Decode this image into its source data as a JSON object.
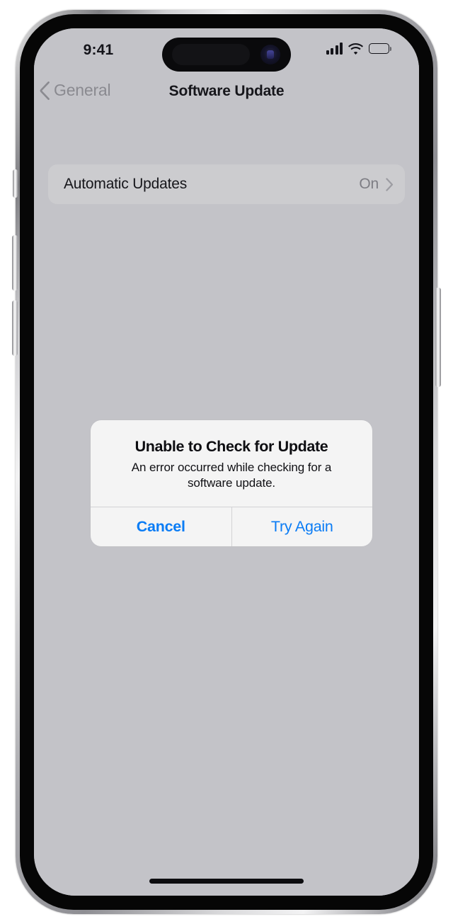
{
  "device": {
    "frame_name": "iphone-frame",
    "buttons": [
      "action-button",
      "volume-up",
      "volume-down",
      "power-button"
    ]
  },
  "status_bar": {
    "time": "9:41",
    "cellular_icon": "cellular-signal-icon",
    "cellular_bars": 4,
    "wifi_icon": "wifi-icon",
    "battery_icon": "battery-icon",
    "battery_level_percent": 100
  },
  "nav_bar": {
    "back_label": "General",
    "back_icon": "chevron-left-icon",
    "title": "Software Update"
  },
  "settings_list": {
    "rows": [
      {
        "label": "Automatic Updates",
        "value": "On",
        "disclosure_icon": "chevron-right-icon"
      }
    ]
  },
  "alert": {
    "title": "Unable to Check for Update",
    "message": "An error occurred while checking for a software update.",
    "actions": [
      {
        "label": "Cancel",
        "emphasis": "bold"
      },
      {
        "label": "Try Again",
        "emphasis": "regular"
      }
    ]
  },
  "home_indicator": "home-indicator",
  "colors": {
    "page_background": "#C3C3C8",
    "row_background": "#CCCCCF",
    "alert_background": "#F4F4F4",
    "accent_blue": "#0A7CF5",
    "primary_text": "#16161B",
    "secondary_text": "#7D7D84"
  }
}
